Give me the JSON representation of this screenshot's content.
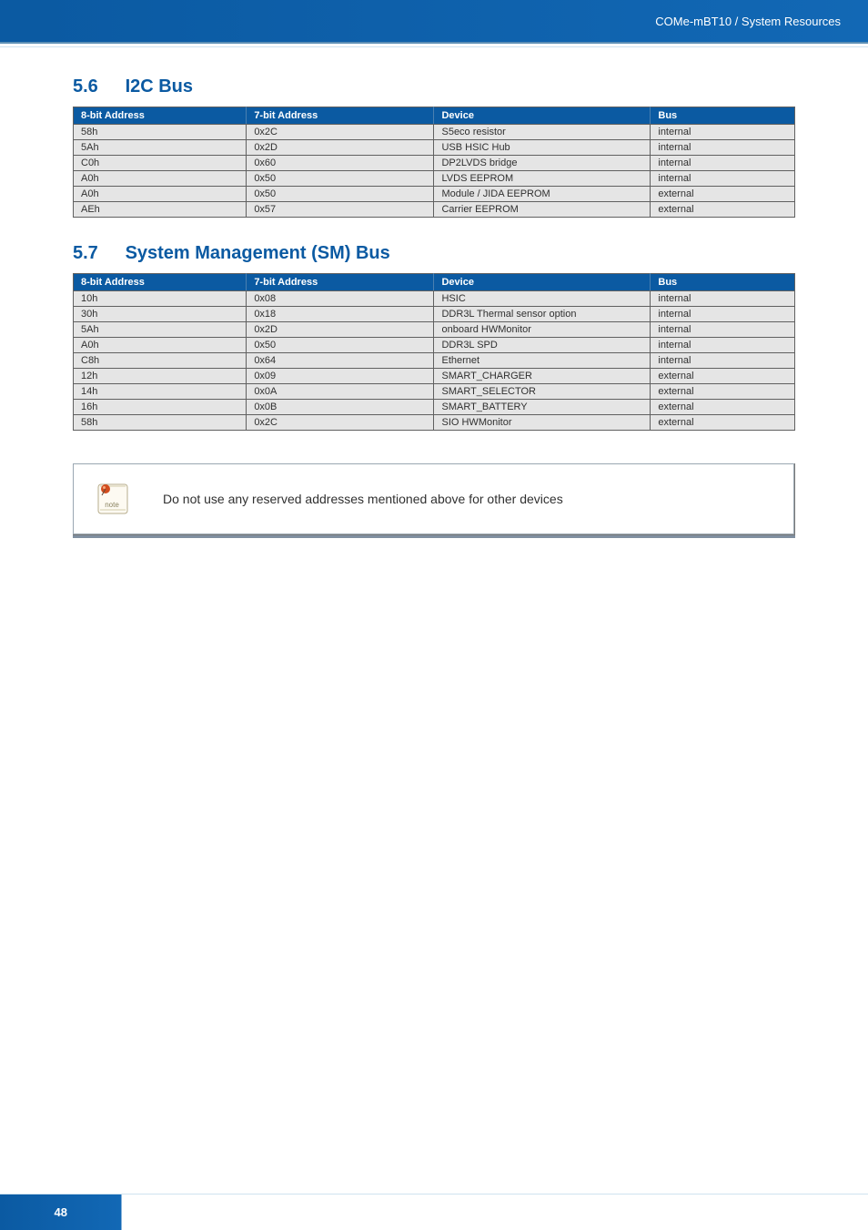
{
  "header": {
    "breadcrumb": "COMe-mBT10 / System Resources"
  },
  "section1": {
    "number": "5.6",
    "title": "I2C Bus",
    "columns": {
      "c1": "8-bit Address",
      "c2": "7-bit Address",
      "c3": "Device",
      "c4": "Bus"
    },
    "rows": [
      {
        "addr8": "58h",
        "addr7": "0x2C",
        "device": "S5eco resistor",
        "bus": "internal"
      },
      {
        "addr8": "5Ah",
        "addr7": "0x2D",
        "device": "USB HSIC Hub",
        "bus": "internal"
      },
      {
        "addr8": "C0h",
        "addr7": "0x60",
        "device": "DP2LVDS bridge",
        "bus": "internal"
      },
      {
        "addr8": "A0h",
        "addr7": "0x50",
        "device": "LVDS EEPROM",
        "bus": "internal"
      },
      {
        "addr8": "A0h",
        "addr7": "0x50",
        "device": "Module / JIDA EEPROM",
        "bus": "external"
      },
      {
        "addr8": "AEh",
        "addr7": "0x57",
        "device": "Carrier EEPROM",
        "bus": "external"
      }
    ]
  },
  "section2": {
    "number": "5.7",
    "title": "System Management (SM) Bus",
    "columns": {
      "c1": "8-bit Address",
      "c2": "7-bit Address",
      "c3": "Device",
      "c4": "Bus"
    },
    "rows": [
      {
        "addr8": "10h",
        "addr7": "0x08",
        "device": "HSIC",
        "bus": "internal"
      },
      {
        "addr8": "30h",
        "addr7": "0x18",
        "device": "DDR3L Thermal sensor option",
        "bus": "internal"
      },
      {
        "addr8": "5Ah",
        "addr7": "0x2D",
        "device": "onboard HWMonitor",
        "bus": "internal"
      },
      {
        "addr8": "A0h",
        "addr7": "0x50",
        "device": "DDR3L SPD",
        "bus": "internal"
      },
      {
        "addr8": "C8h",
        "addr7": "0x64",
        "device": "Ethernet",
        "bus": "internal"
      },
      {
        "addr8": "12h",
        "addr7": "0x09",
        "device": "SMART_CHARGER",
        "bus": "external"
      },
      {
        "addr8": "14h",
        "addr7": "0x0A",
        "device": "SMART_SELECTOR",
        "bus": "external"
      },
      {
        "addr8": "16h",
        "addr7": "0x0B",
        "device": "SMART_BATTERY",
        "bus": "external"
      },
      {
        "addr8": "58h",
        "addr7": "0x2C",
        "device": "SIO HWMonitor",
        "bus": "external"
      }
    ]
  },
  "callout": {
    "icon_label": "note",
    "text": "Do not use any reserved addresses mentioned above for other devices"
  },
  "footer": {
    "page_number": "48"
  }
}
